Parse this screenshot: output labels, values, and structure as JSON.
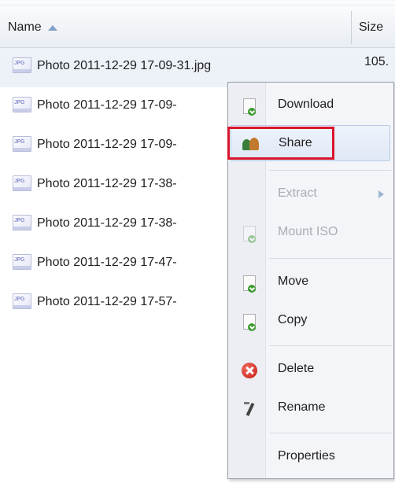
{
  "header": {
    "name_label": "Name",
    "size_label": "Size"
  },
  "files": [
    {
      "name": "Photo 2011-12-29 17-09-31.jpg",
      "size": "105.",
      "selected": true
    },
    {
      "name": "Photo 2011-12-29 17-09-"
    },
    {
      "name": "Photo 2011-12-29 17-09-"
    },
    {
      "name": "Photo 2011-12-29 17-38-"
    },
    {
      "name": "Photo 2011-12-29 17-38-"
    },
    {
      "name": "Photo 2011-12-29 17-47-"
    },
    {
      "name": "Photo 2011-12-29 17-57-"
    }
  ],
  "file_icon_tag": "JPG",
  "context_menu": {
    "download": "Download",
    "share": "Share",
    "extract": "Extract",
    "mount_iso": "Mount ISO",
    "move": "Move",
    "copy": "Copy",
    "delete": "Delete",
    "rename": "Rename",
    "properties": "Properties"
  },
  "highlight_color": "#d9142b",
  "icons": {
    "sort": "sort-ascending-icon",
    "file": "jpg-file-icon",
    "download": "download-icon",
    "share": "share-users-icon",
    "extract_submenu": "submenu-arrow-icon",
    "mount_iso": "mount-iso-icon",
    "move": "move-icon",
    "copy": "copy-icon",
    "delete": "delete-icon",
    "rename": "rename-icon"
  }
}
